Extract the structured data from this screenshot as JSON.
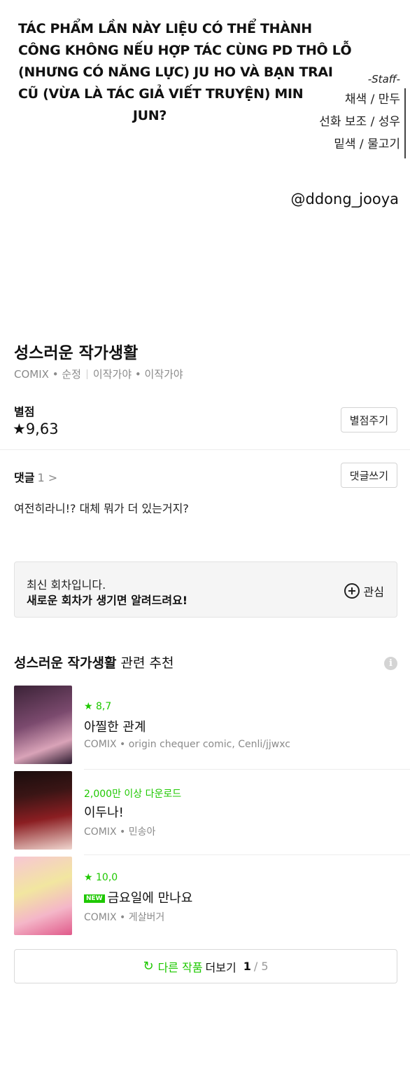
{
  "panel": {
    "promo_lines": [
      "TÁC PHẨM LẦN NÀY LIỆU CÓ THỂ THÀNH",
      "CÔNG KHÔNG NẾU HỢP TÁC CÙNG PD THÔ LỖ",
      "(NHƯNG CÓ NĂNG LỰC) JU HO VÀ BẠN TRAI",
      "CŨ (VỪA LÀ TÁC GIẢ VIẾT TRUYỆN) MIN",
      "JUN?"
    ],
    "staff_title": "-Staff-",
    "staff_lines": [
      "채색 / 만두",
      "선화 보조 / 성우",
      "밑색 / 물고기"
    ],
    "handle": "@ddong_jooya"
  },
  "work": {
    "title": "성스러운 작가생활",
    "platform": "COMIX",
    "genre": "순정",
    "author_story": "이작가야",
    "author_art": "이작가야"
  },
  "rating": {
    "label": "별점",
    "value": "★9,63",
    "button": "별점주기"
  },
  "comments": {
    "label": "댓글",
    "count": "1 >",
    "button": "댓글쓰기",
    "top_comment": "여전히라니!? 대체 뭐가 더 있는거지?"
  },
  "notice": {
    "line1": "최신 회차입니다.",
    "line2": "새로운 회차가 생기면 알려드려요!",
    "subscribe": "관심"
  },
  "recommend": {
    "title_bold": "성스러운 작가생활",
    "title_rest": "관련 추천",
    "info_icon": "i",
    "items": [
      {
        "stat": "★ 8,7",
        "name": "아찔한 관계",
        "meta": "COMIX • origin chequer comic, Cenli/jjwxc",
        "new": false,
        "thumb_colors": [
          "#2b1a2e",
          "#7b4a6e",
          "#d9a3b8"
        ]
      },
      {
        "stat": "2,000만 이상 다운로드",
        "name": "이두나!",
        "meta": "COMIX • 민송아",
        "new": false,
        "thumb_colors": [
          "#1a0d0d",
          "#8b1e22",
          "#f0d6cf"
        ]
      },
      {
        "stat": "★ 10,0",
        "name": "금요일에 만나요",
        "meta": "COMIX • 게살버거",
        "new": true,
        "new_label": "NEW",
        "thumb_colors": [
          "#f7c6d4",
          "#f2e6a0",
          "#e05a8a"
        ]
      }
    ]
  },
  "more": {
    "label_green": "다른 작품",
    "label_rest": "더보기",
    "page_current": "1",
    "page_total": "/ 5"
  },
  "colors": {
    "accent": "#1ec800",
    "muted": "#8a8a8a"
  }
}
